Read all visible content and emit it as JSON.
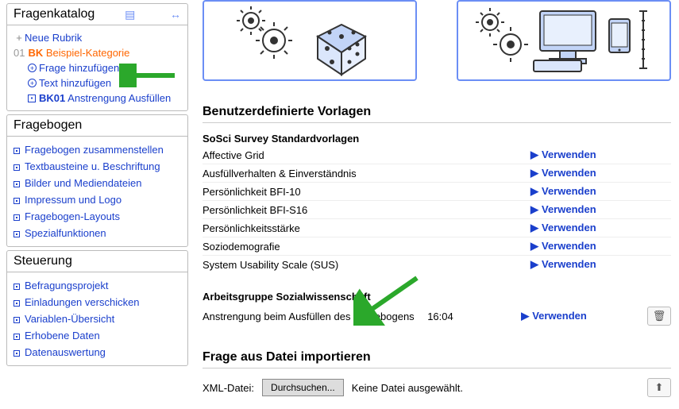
{
  "sidebar": {
    "catalog": {
      "title": "Fragenkatalog",
      "newSection": "Neue Rubrik",
      "catId": "01",
      "catCode": "BK",
      "catName": "Beispiel-Kategorie",
      "addQuestion": "Frage hinzufügen",
      "addText": "Text hinzufügen",
      "itemCode": "BK01",
      "itemName": "Anstrengung Ausfüllen"
    },
    "survey": {
      "title": "Fragebogen",
      "items": [
        "Fragebogen zusammenstellen",
        "Textbausteine u. Beschriftung",
        "Bilder und Mediendateien",
        "Impressum und Logo",
        "Fragebogen-Layouts",
        "Spezialfunktionen"
      ]
    },
    "control": {
      "title": "Steuerung",
      "items": [
        "Befragungsprojekt",
        "Einladungen verschicken",
        "Variablen-Übersicht",
        "Erhobene Daten",
        "Datenauswertung"
      ]
    }
  },
  "main": {
    "userTemplates": "Benutzerdefinierte Vorlagen",
    "stdHeader": "SoSci Survey Standardvorlagen",
    "stdTemplates": [
      "Affective Grid",
      "Ausfüllverhalten & Einverständnis",
      "Persönlichkeit BFI-10",
      "Persönlichkeit BFI-S16",
      "Persönlichkeitsstärke",
      "Soziodemografie",
      "System Usability Scale (SUS)"
    ],
    "useLabel": "Verwenden",
    "group2Header": "Arbeitsgruppe Sozialwissenschaft",
    "group2Item": "Anstrengung beim Ausfüllen des Fragebogens",
    "group2Time": "16:04",
    "importTitle": "Frage aus Datei importieren",
    "xmlLabel": "XML-Datei:",
    "browseLabel": "Durchsuchen...",
    "noFile": "Keine Datei ausgewählt."
  }
}
